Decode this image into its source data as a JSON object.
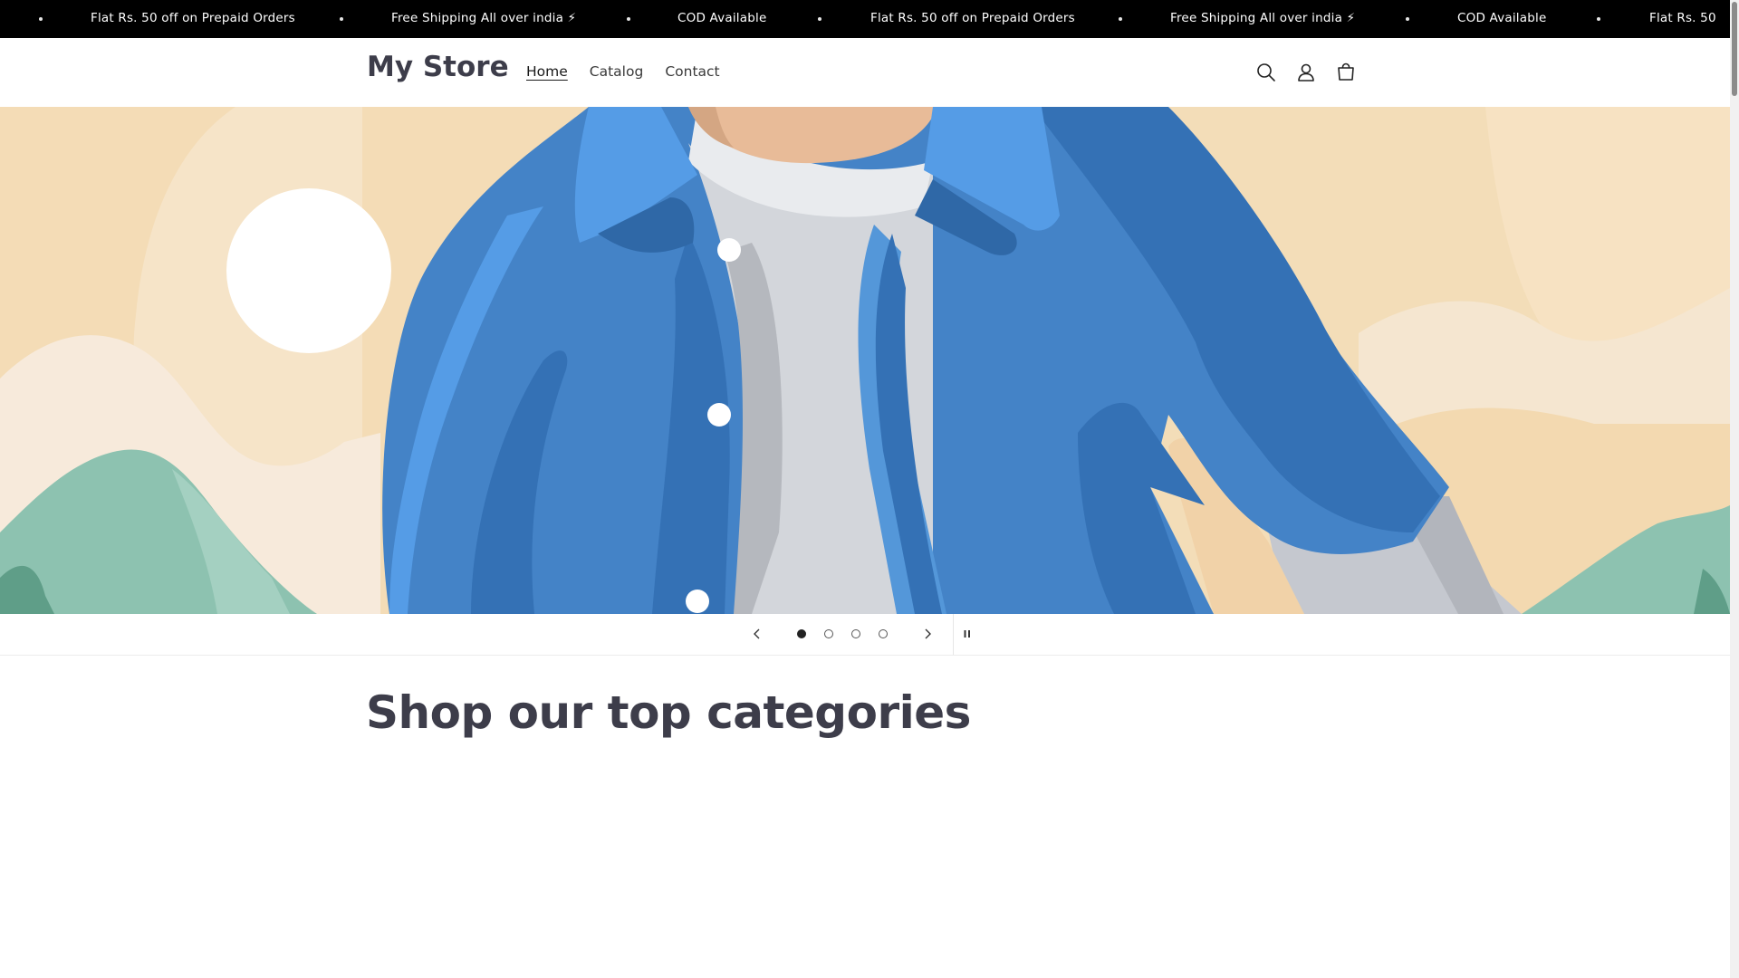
{
  "announcement": {
    "messages": [
      "Flat Rs. 50 off on Prepaid Orders",
      "Free Shipping All over india ⚡",
      "COD Available",
      "Flat Rs. 50 off on Prepaid Orders",
      "Free Shipping All over india ⚡",
      "COD Available",
      "Flat Rs. 50"
    ]
  },
  "header": {
    "logo": "My Store",
    "nav": [
      "Home",
      "Catalog",
      "Contact"
    ],
    "active_nav": "Home",
    "icons": [
      "search-icon",
      "account-icon",
      "cart-icon"
    ]
  },
  "slideshow": {
    "slide_count": 4,
    "active_slide": 1,
    "controls": [
      "previous-icon",
      "next-icon",
      "pause-icon"
    ]
  },
  "section": {
    "title": "Shop our top categories"
  },
  "colors": {
    "announcement_bg": "#000000",
    "heading": "#3d3d4a",
    "hero_sand": "#f3ddb8",
    "jacket_blue": "#4483c7",
    "hill_green": "#8dc2b0"
  }
}
